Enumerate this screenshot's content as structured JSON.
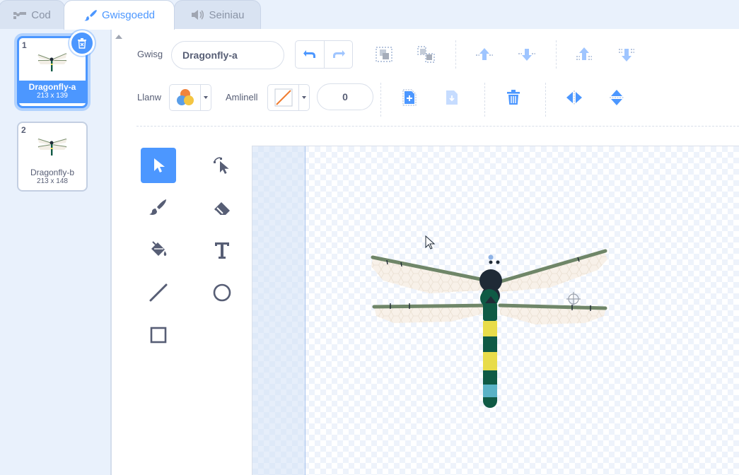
{
  "tabs": [
    {
      "label": "Cod",
      "icon": "code-icon"
    },
    {
      "label": "Gwisgoedd",
      "icon": "paintbrush-icon"
    },
    {
      "label": "Seiniau",
      "icon": "speaker-icon"
    }
  ],
  "costumes": [
    {
      "number": "1",
      "name": "Dragonfly-a",
      "size": "213 x 139"
    },
    {
      "number": "2",
      "name": "Dragonfly-b",
      "size": "213 x 148"
    }
  ],
  "editor": {
    "costume_label": "Gwisg",
    "costume_name": "Dragonfly-a",
    "fill_label": "Llanw",
    "outline_label": "Amlinell",
    "outline_width": "0"
  },
  "colors": {
    "accent": "#4c97ff",
    "text": "#575e75",
    "outline_swatch": "#f07d31"
  }
}
